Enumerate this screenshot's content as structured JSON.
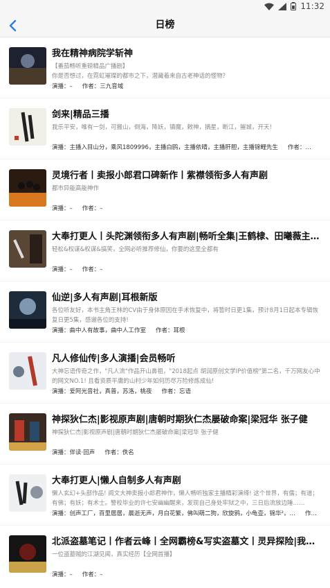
{
  "status": {
    "time": "11:32"
  },
  "header": {
    "title": "日榜"
  },
  "items": [
    {
      "title": "我在精神病院学斩神",
      "desc": "【番茄畅听重磅精品广播剧】\n你是否想过，在霓虹璀璨的都市之下，潜藏着来自古老神话的怪物？",
      "performer_label": "演播：",
      "performer": "–",
      "author_label": "作者：",
      "author": "三九音域"
    },
    {
      "title": "剑来|精品三播",
      "desc": "我乐平安，唯有一剑，可搬山，倒海，降妖，镇魔，敕神，摘星，断江，摧城，开天！",
      "performer_label": "演播：",
      "performer": "主播入目山分，乘风1809996，主播白鸥，主播依晴，主播肝胆，主播锦鲤先生",
      "author_label": "作者：",
      "author": "…"
    },
    {
      "title": "灵境行者丨卖报小郎君口碑新作丨紫襟领衔多人有声剧",
      "desc": "都市异能高能神作",
      "performer_label": "演播：",
      "performer": "–",
      "author_label": "作者：",
      "author": "–"
    },
    {
      "title": "大奉打更人丨头陀渊领衔多人有声剧|畅听全集|王鹤棣、田曦薇主演…",
      "desc": "轻松&权谋&权谋&搞笑，全网必听推荐修仙，你要的这里全都有",
      "performer_label": "演播：",
      "performer": "–",
      "author_label": "作者：",
      "author": "–"
    },
    {
      "title": "仙逆|多人有声剧|耳根新版",
      "desc": "各位听友好，本书主角王林的CV由于身体原因在手术恢复中，将暂时日更1集，预计8月1日起本专辑恢复日更5集，感谢各位的支持!",
      "performer_label": "演播：",
      "performer": "曲中人有故事，曲中人工作室",
      "author_label": "作者：",
      "author": "耳根"
    },
    {
      "title": "凡人修仙传|多人演播|会员畅听",
      "desc": "大神忘语传奇之作，\"凡人流\"作品开山鼻祖，\"2018起点 胡润原创文学IP价值榜\"第二名，千万网友心中的网文NO.1! 且看资质平庸的山村少年如何历尽万险修炼成仙!",
      "performer_label": "演播：",
      "performer": "爱阿光音社，真普，苏洛，桃夜",
      "author_label": "作者：",
      "author": "忘语"
    },
    {
      "title": "神探狄仁杰|影视原声剧|唐朝时期狄仁杰屡破命案|梁冠华 张子健",
      "desc": "神探狄仁杰|影视原声剧|唐朝时期狄仁杰屡破命案|梁冠华 张子健",
      "performer_label": "演播：",
      "performer": "伴读·回声",
      "author_label": "作者：",
      "author": "佚名"
    },
    {
      "title": "大奉打更人|懒人自制多人有声剧",
      "desc": "懒人玄幻+头部作品! 阅文大神卖报小郎君神作，懒人畅听独家主播精彩演绎! 这个世界，有儒；有道；有佛；有妖；有术士。警校毕业的许七安幽幽醒来，发现自己身处牢狱之中，三日后流放边陲……",
      "performer_label": "演播：",
      "performer": "创声工厂，百里居居，晨逝无声，月白花繁，佛叫萌二狗，欣旋鸦，小龟壶，锦华²，…",
      "author_label": "作者：",
      "author": ""
    },
    {
      "title": "北派盗墓笔记丨作者云峰丨全网霸榜&写实盗墓文丨灵异探险|我在地底…",
      "desc": "一位盗墓贼的江湖见闻，真实经历【全网首播】",
      "performer_label": "演播：",
      "performer": "–",
      "author_label": "作者：",
      "author": "–"
    }
  ]
}
